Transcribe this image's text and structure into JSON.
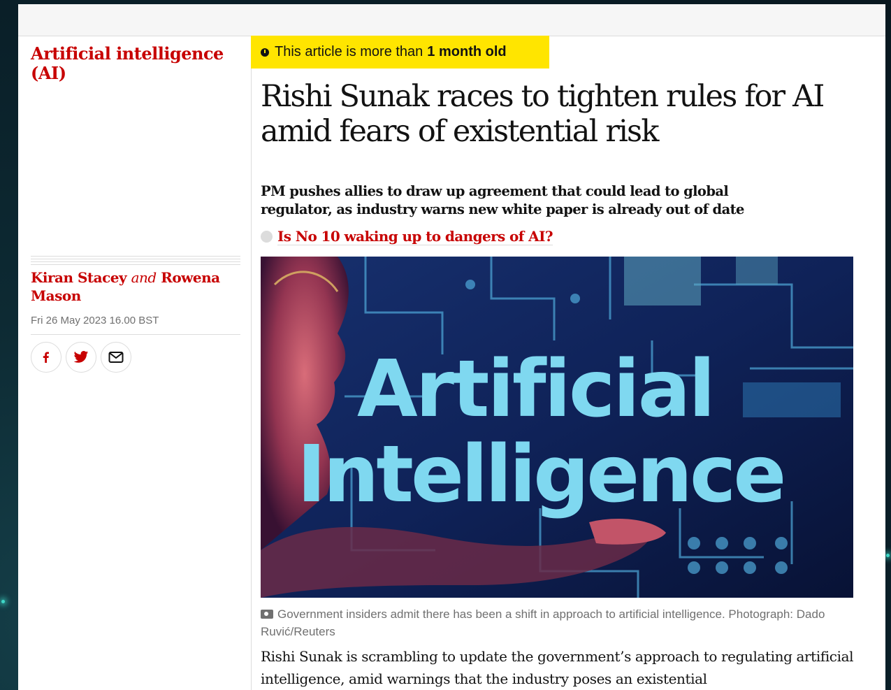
{
  "section": {
    "label": "Artificial intelligence (AI)"
  },
  "byline": {
    "author1": "Kiran Stacey",
    "conjunction": "and",
    "author2": "Rowena Mason"
  },
  "dateline": "Fri 26 May 2023 16.00 BST",
  "share": {
    "icons": [
      "facebook-icon",
      "twitter-icon",
      "email-icon"
    ]
  },
  "age_badge": {
    "prefix": "This article is more than",
    "emphasis": "1 month old"
  },
  "headline": "Rishi Sunak races to tighten rules for AI amid fears of existential risk",
  "standfirst": "PM pushes allies to draw up agreement that could lead to global regulator, as industry warns new white paper is already out of date",
  "related_link": "Is No 10 waking up to dangers of AI?",
  "hero": {
    "line1": "Artificial",
    "line2": "Intelligence"
  },
  "caption": "Government insiders admit there has been a shift in approach to artificial intelligence. Photograph: Dado Ruvić/Reuters",
  "body": "Rishi Sunak is scrambling to update the government’s approach to regulating artificial intelligence, amid warnings that the industry poses an existential",
  "colors": {
    "accent_red": "#c70000",
    "badge_yellow": "#ffe500",
    "text": "#121212",
    "muted": "#707070"
  }
}
